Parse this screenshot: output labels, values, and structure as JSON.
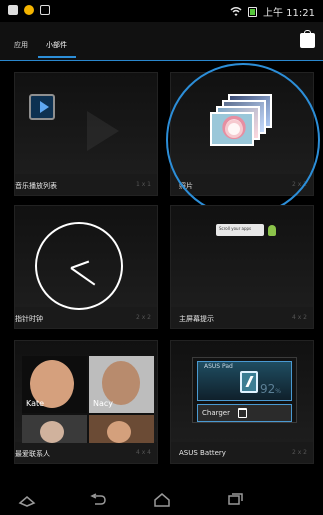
{
  "statusbar": {
    "time": "上午 11:21"
  },
  "tabs": {
    "apps": "应用",
    "widgets": "小部件"
  },
  "widgets": [
    {
      "name": "音乐播放列表",
      "size": "1 x 1"
    },
    {
      "name": "照片",
      "size": "2 x 2"
    },
    {
      "name": "指针时钟",
      "size": "2 x 2"
    },
    {
      "name": "主屏幕提示",
      "size": "4 x 2"
    },
    {
      "name": "最爱联系人",
      "size": "4 x 4"
    },
    {
      "name": "ASUS Battery",
      "size": "2 x 2"
    }
  ],
  "contacts": {
    "c1": "Kate",
    "c2": "Nacy"
  },
  "battery_widget": {
    "title": "ASUS Pad",
    "percent": "92",
    "unit": "%",
    "charger": "Charger"
  },
  "home_tip": {
    "text": "Scroll your apps"
  }
}
